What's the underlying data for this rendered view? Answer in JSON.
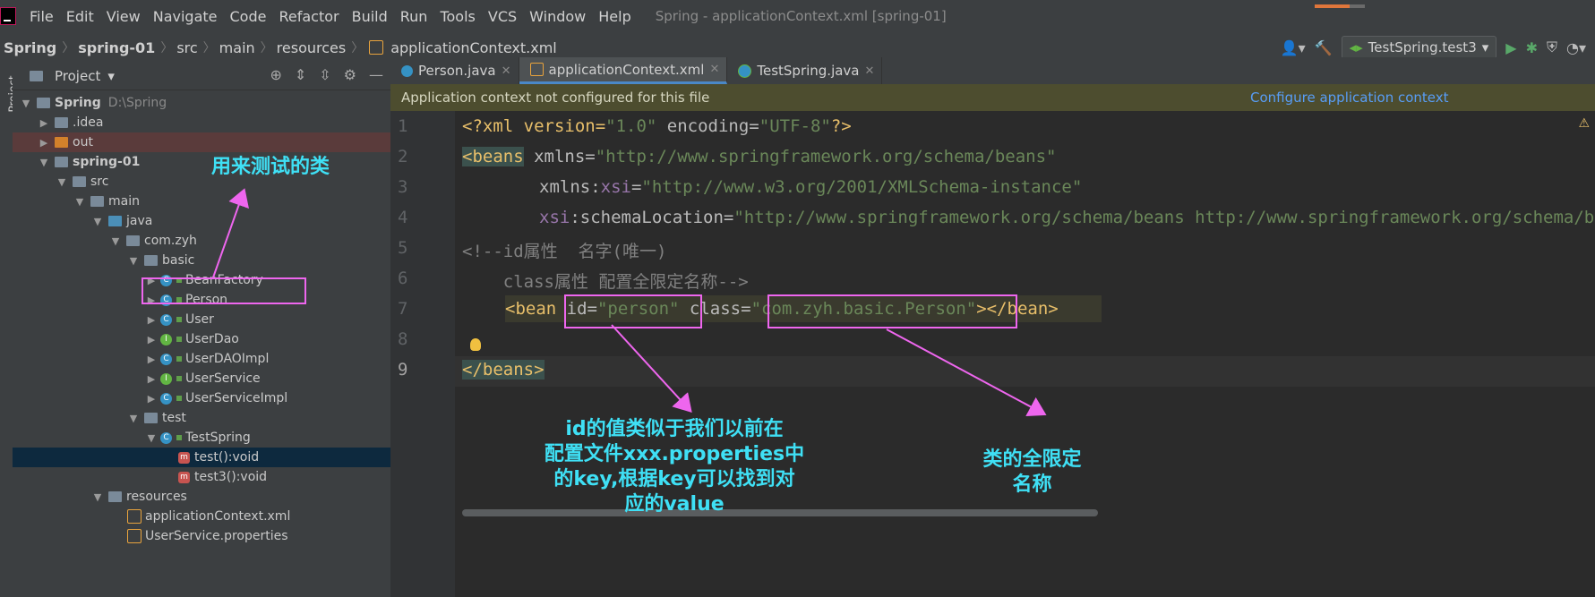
{
  "menubar": {
    "items": [
      "File",
      "Edit",
      "View",
      "Navigate",
      "Code",
      "Refactor",
      "Build",
      "Run",
      "Tools",
      "VCS",
      "Window",
      "Help"
    ],
    "title": "Spring - applicationContext.xml [spring-01]",
    "progress": 0.7
  },
  "breadcrumb": [
    "Spring",
    "spring-01",
    "src",
    "main",
    "resources",
    "applicationContext.xml"
  ],
  "run_config": "TestSpring.test3",
  "sidebar_strip": "Project",
  "project": {
    "title": "Project",
    "tree": [
      {
        "label": "Spring",
        "hint": "D:\\Spring",
        "level": 0,
        "arrow": "▼",
        "icon": "folder",
        "bold": true
      },
      {
        "label": ".idea",
        "level": 1,
        "arrow": "▶",
        "icon": "folder"
      },
      {
        "label": "out",
        "level": 1,
        "arrow": "▶",
        "icon": "folder-orange",
        "cls": "out"
      },
      {
        "label": "spring-01",
        "level": 1,
        "arrow": "▼",
        "icon": "folder",
        "bold": true
      },
      {
        "label": "src",
        "level": 2,
        "arrow": "▼",
        "icon": "folder"
      },
      {
        "label": "main",
        "level": 3,
        "arrow": "▼",
        "icon": "folder"
      },
      {
        "label": "java",
        "level": 4,
        "arrow": "▼",
        "icon": "folder-blue"
      },
      {
        "label": "com.zyh",
        "level": 5,
        "arrow": "▼",
        "icon": "pkg"
      },
      {
        "label": "basic",
        "level": 6,
        "arrow": "▼",
        "icon": "pkg"
      },
      {
        "label": "BeanFactory",
        "level": 7,
        "arrow": "▶",
        "icon": "class"
      },
      {
        "label": "Person",
        "level": 7,
        "arrow": "▶",
        "icon": "class"
      },
      {
        "label": "User",
        "level": 7,
        "arrow": "▶",
        "icon": "class"
      },
      {
        "label": "UserDao",
        "level": 7,
        "arrow": "▶",
        "icon": "interface"
      },
      {
        "label": "UserDAOImpl",
        "level": 7,
        "arrow": "▶",
        "icon": "class"
      },
      {
        "label": "UserService",
        "level": 7,
        "arrow": "▶",
        "icon": "interface"
      },
      {
        "label": "UserServiceImpl",
        "level": 7,
        "arrow": "▶",
        "icon": "class"
      },
      {
        "label": "test",
        "level": 6,
        "arrow": "▼",
        "icon": "pkg"
      },
      {
        "label": "TestSpring",
        "level": 7,
        "arrow": "▼",
        "icon": "spring"
      },
      {
        "label": "test():void",
        "level": 8,
        "arrow": "",
        "icon": "method",
        "cls": "sel"
      },
      {
        "label": "test3():void",
        "level": 8,
        "arrow": "",
        "icon": "method"
      },
      {
        "label": "resources",
        "level": 4,
        "arrow": "▼",
        "icon": "folder"
      },
      {
        "label": "applicationContext.xml",
        "level": 5,
        "arrow": "",
        "icon": "xml"
      },
      {
        "label": "UserService.properties",
        "level": 5,
        "arrow": "",
        "icon": "xml"
      }
    ]
  },
  "tabs": [
    {
      "label": "Person.java",
      "icon": "class"
    },
    {
      "label": "applicationContext.xml",
      "icon": "xml",
      "active": true
    },
    {
      "label": "TestSpring.java",
      "icon": "spring"
    }
  ],
  "banner": {
    "message": "Application context not configured for this file",
    "link": "Configure application context"
  },
  "line_numbers": [
    "1",
    "2",
    "3",
    "4",
    "5",
    "6",
    "7",
    "8",
    "9"
  ],
  "code": {
    "l1": {
      "a": "<?xml version=",
      "b": "\"1.0\"",
      "c": " encoding=",
      "d": "\"UTF-8\"",
      "e": "?>"
    },
    "l2": {
      "a": "<beans",
      "b": " xmlns=",
      "c": "\"http://www.springframework.org/schema/beans\""
    },
    "l3": {
      "a": "xmlns:",
      "b": "xsi",
      "c": "=",
      "d": "\"http://www.w3.org/2001/XMLSchema-instance\""
    },
    "l4": {
      "a": "xsi",
      "b": ":schemaLocation=",
      "c": "\"http://www.springframework.org/schema/beans http://www.springframework.org/schema/beans/spring-beans.xsd\""
    },
    "l5": "<!--id属性  名字(唯一)",
    "l6": "    class属性 配置全限定名称-->",
    "l7": {
      "a": "<bean ",
      "b": "id=",
      "c": "\"person\"",
      "d": " class=",
      "e": "\"com.zyh.basic.Person\"",
      "f": "></bean>"
    },
    "l9": "</beans>"
  },
  "annotations": {
    "test_class": "用来测试的类",
    "id_note": [
      "id的值类似于我们以前在",
      "配置文件xxx.properties中",
      "的key,根据key可以找到对",
      "应的value"
    ],
    "class_note": [
      "类的全限定",
      "名称"
    ]
  },
  "colors": {
    "annotation_text": "#3fe0f5",
    "annotation_box": "#ee66ee"
  }
}
